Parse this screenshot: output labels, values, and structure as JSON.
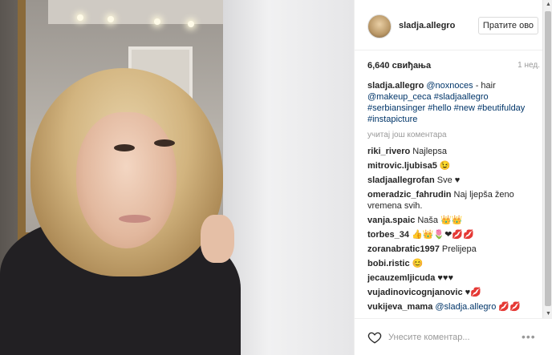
{
  "post": {
    "username": "sladja.allegro",
    "follow_label": "Пратите ово",
    "likes": "6,640 свиђања",
    "time_ago": "1 нед."
  },
  "caption": {
    "username": "sladja.allegro",
    "mention1": "@noxnoces",
    "text1": " - hair ",
    "mention2": "@makeup_ceca",
    "hashtags": "#sladjaallegro #serbiansinger #hello #new #beutifulday #instapicture"
  },
  "load_more": "учитај још коментара",
  "comments": [
    {
      "user": "riki_rivero",
      "text": "Najlepsa"
    },
    {
      "user": "mitrovic.ljubisa5",
      "text": "😉"
    },
    {
      "user": "sladjaallegrofan",
      "text": "Sve ♥"
    },
    {
      "user": "omeradzic_fahrudin",
      "text": "Naj ljepša ženo vremena svih."
    },
    {
      "user": "vanja.spaic",
      "text": "Naša 👑👑"
    },
    {
      "user": "torbes_34",
      "text": "👍👑🌷❤💋💋"
    },
    {
      "user": "zoranabratic1997",
      "text": "Prelijepa"
    },
    {
      "user": "bobi.ristic",
      "text": "😊"
    },
    {
      "user": "jecauzemljicuda",
      "text": "♥♥♥"
    },
    {
      "user": "vujadinovicognjanovic",
      "text": "♥💋"
    },
    {
      "user": "vukijeva_mama",
      "mention": "@sladja.allegro",
      "text": " 💋💋"
    }
  ],
  "footer": {
    "placeholder": "Унесите коментар...",
    "more_label": "•••"
  },
  "icons": {
    "heart": "heart-icon",
    "more": "more-options-icon"
  }
}
